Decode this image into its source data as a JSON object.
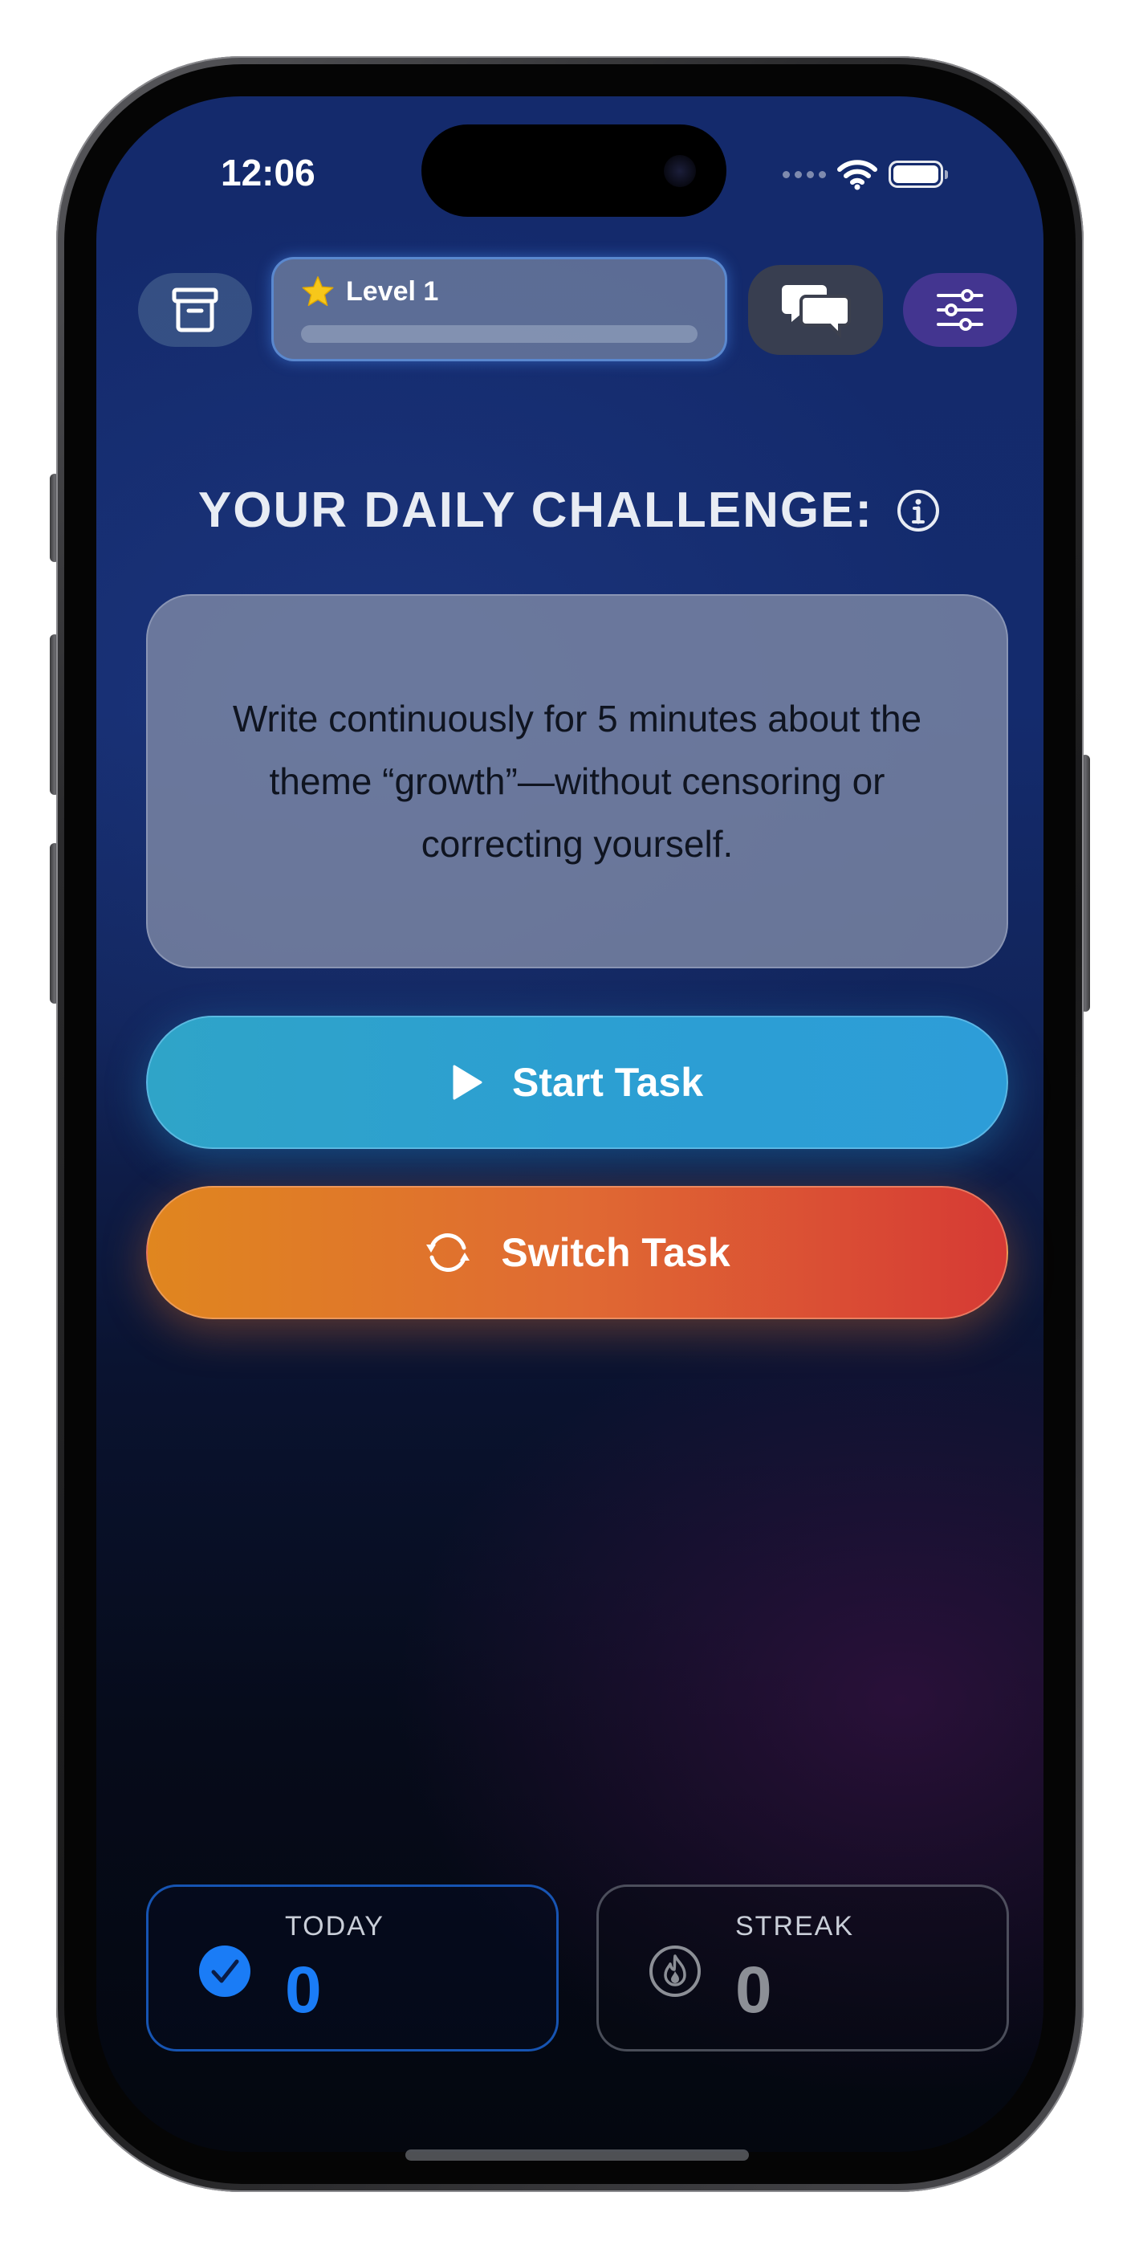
{
  "status_bar": {
    "time": "12:06",
    "icons": [
      "cellular-dots-icon",
      "wifi-icon",
      "battery-icon"
    ]
  },
  "toolbar": {
    "archive_icon": "archive-box-icon",
    "level": {
      "star_icon": "star-icon",
      "label": "Level 1",
      "progress": 0.0
    },
    "chat_icon": "chat-bubbles-icon",
    "settings_icon": "sliders-icon"
  },
  "challenge": {
    "heading": "YOUR DAILY CHALLENGE:",
    "info_icon": "info-circle-icon",
    "text": "Write continuously for 5 minutes about the theme “growth”—without censoring or correcting yourself."
  },
  "actions": {
    "start": {
      "label": "Start Task",
      "icon": "play-icon"
    },
    "switch": {
      "label": "Switch Task",
      "icon": "refresh-icon"
    }
  },
  "stats": {
    "today": {
      "label": "TODAY",
      "value": "0",
      "icon": "checkmark-circle-icon"
    },
    "streak": {
      "label": "STREAK",
      "value": "0",
      "icon": "flame-icon"
    }
  },
  "colors": {
    "accent_blue": "#1a7cf6",
    "start_gradient": [
      "#2fa4c8",
      "#2d9dd8"
    ],
    "switch_gradient": [
      "#e0861f",
      "#d63a34"
    ],
    "background_top": "#142a6c",
    "background_bottom": "#04070f"
  }
}
